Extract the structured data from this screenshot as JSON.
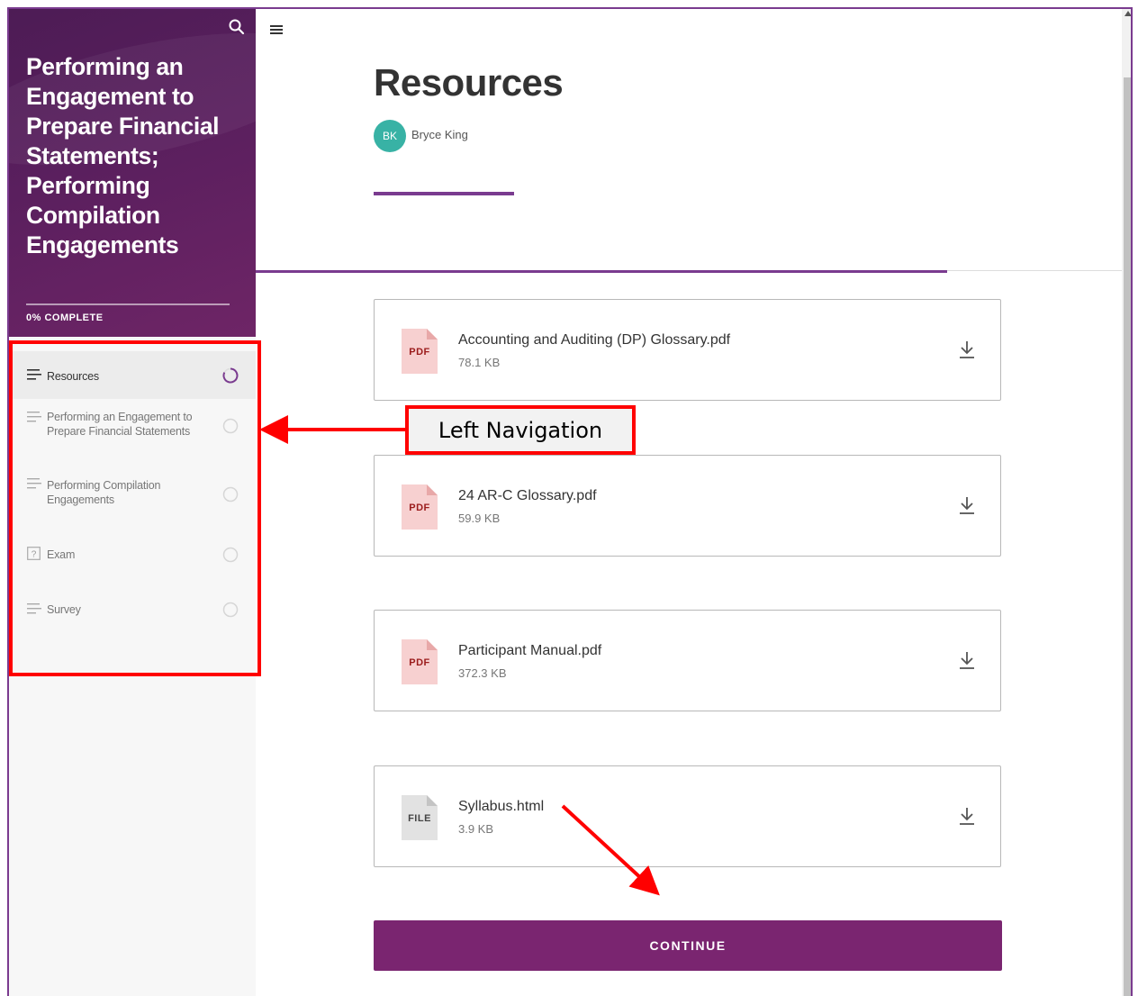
{
  "course": {
    "title": "Performing an Engagement to Prepare Financial Statements; Performing Compilation Engagements",
    "progress_text": "0% COMPLETE",
    "progress_percent": 0
  },
  "nav": {
    "items": [
      {
        "label": "Resources",
        "icon": "lesson-lines-icon",
        "status": "in-progress",
        "active": true
      },
      {
        "label": "Performing an Engagement to Prepare Financial Statements",
        "icon": "lesson-lines-icon",
        "status": "not-started",
        "active": false
      },
      {
        "label": "Performing Compilation Engagements",
        "icon": "lesson-lines-icon",
        "status": "not-started",
        "active": false
      },
      {
        "label": "Exam",
        "icon": "question-box-icon",
        "status": "not-started",
        "active": false
      },
      {
        "label": "Survey",
        "icon": "lesson-lines-icon",
        "status": "not-started",
        "active": false
      }
    ]
  },
  "page": {
    "title": "Resources",
    "author_initials": "BK",
    "author_name": "Bryce King"
  },
  "resources": [
    {
      "name": "Accounting and Auditing (DP) Glossary.pdf",
      "size": "78.1 KB",
      "type": "PDF"
    },
    {
      "name": "24 AR-C Glossary.pdf",
      "size": "59.9 KB",
      "type": "PDF"
    },
    {
      "name": "Participant Manual.pdf",
      "size": "372.3 KB",
      "type": "PDF"
    },
    {
      "name": "Syllabus.html",
      "size": "3.9 KB",
      "type": "FILE"
    }
  ],
  "continue_label": "CONTINUE",
  "annotation": {
    "callout_text": "Left Navigation"
  },
  "colors": {
    "brand": "#7a2570",
    "accent": "#7a3b8f",
    "avatar": "#38b2a5",
    "annotation": "#ff0000",
    "pdf_icon": "#f7d0d0",
    "pdf_text": "#9b1c1c",
    "file_icon": "#e2e2e2"
  }
}
